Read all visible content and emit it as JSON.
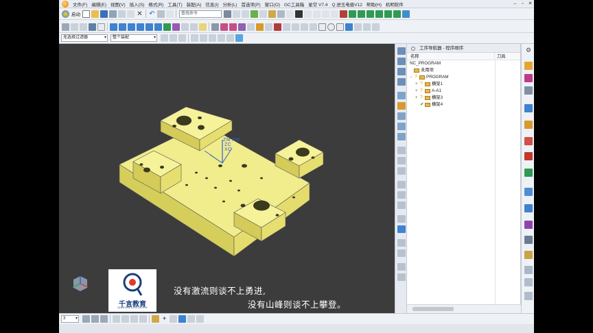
{
  "menubar": {
    "items": [
      "文件(F)",
      "编辑(E)",
      "视图(V)",
      "插入(S)",
      "格式(R)",
      "工具(T)",
      "装配(A)",
      "信息(I)",
      "分析(L)",
      "首选项(P)",
      "窗口(O)",
      "GC工具箱",
      "星空 V7.4",
      "Q 进玉电极V12",
      "帮助(H)",
      "机明软件"
    ]
  },
  "toolbar1": {
    "start_label": "启动",
    "search_placeholder": "查找命令"
  },
  "filterbar": {
    "filter_value": "无选择过滤器",
    "scope_value": "整个装配"
  },
  "viewport": {
    "axis_labels": {
      "zm": "ZM",
      "xm": "XM",
      "zc": "ZC",
      "xc": "XC"
    },
    "logo_text": "千言教育",
    "logo_sub": "QIANYAN EDUCATION",
    "subtitle_line1": "没有激流则谈不上勇进,",
    "subtitle_line2": "没有山峰则谈不上攀登。"
  },
  "statusbar": {
    "snap_value": "3"
  },
  "navigator": {
    "title": "工序导航器 - 程序顺序",
    "col_name": "名称",
    "col_tool": "刀具",
    "rows": [
      {
        "label": "NC_PROGRAM",
        "level": 0,
        "expander": "",
        "status": ""
      },
      {
        "label": "未用项",
        "level": 1,
        "expander": "",
        "status": ""
      },
      {
        "label": "PROGRAM",
        "level": 1,
        "expander": "−",
        "status": "?"
      },
      {
        "label": "横架1",
        "level": 2,
        "expander": "+",
        "status": "?"
      },
      {
        "label": "A-A1",
        "level": 2,
        "expander": "+",
        "status": "?"
      },
      {
        "label": "横架3",
        "level": 2,
        "expander": "+",
        "status": "?"
      },
      {
        "label": "横架4",
        "level": 2,
        "expander": "",
        "status": "✔"
      }
    ]
  },
  "colors": {
    "part_top": "#f2ee8f",
    "part_front": "#d4cc5a",
    "part_side": "#e6df70",
    "viewport_bg": "#3c3c3c",
    "warning_status": "#e0a800",
    "ok_status": "#2e9a2e"
  }
}
